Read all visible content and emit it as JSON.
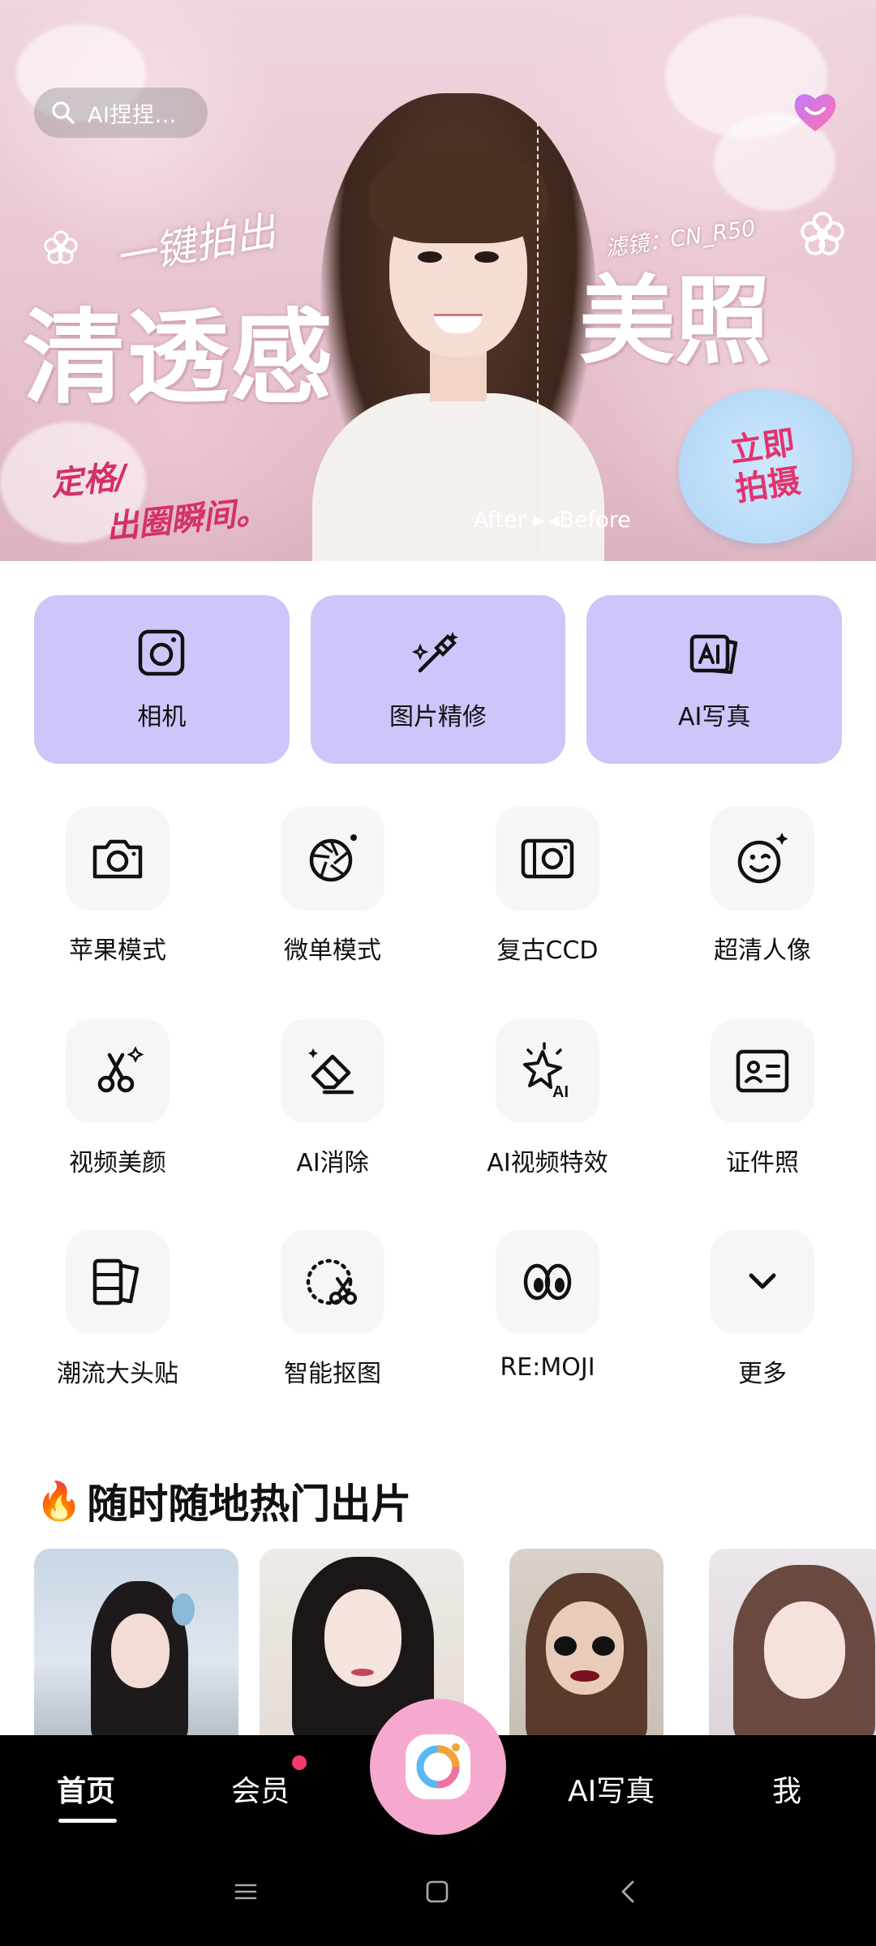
{
  "banner": {
    "search_text": "AI捏捏…",
    "slogan_small": "一键拍出",
    "slogan_big": "清透感",
    "slogan_right": "美照",
    "filter_label": "滤镜：CN_R50",
    "tagline_line1": "定格/",
    "tagline_line2": "出圈瞬间。",
    "after_label": "After ▸",
    "before_label": "◂Before",
    "cta_line1": "立即",
    "cta_line2": "拍摄"
  },
  "main_cards": [
    {
      "label": "相机",
      "icon": "camera-square-icon"
    },
    {
      "label": "图片精修",
      "icon": "magic-brush-icon"
    },
    {
      "label": "AI写真",
      "icon": "ai-photo-icon"
    }
  ],
  "tools": [
    {
      "label": "苹果模式",
      "icon": "camera-icon"
    },
    {
      "label": "微单模式",
      "icon": "aperture-icon"
    },
    {
      "label": "复古CCD",
      "icon": "ccd-camera-icon"
    },
    {
      "label": "超清人像",
      "icon": "wink-face-icon"
    },
    {
      "label": "视频美颜",
      "icon": "scissors-sparkle-icon"
    },
    {
      "label": "AI消除",
      "icon": "eraser-icon"
    },
    {
      "label": "AI视频特效",
      "icon": "ai-sparkle-icon"
    },
    {
      "label": "证件照",
      "icon": "id-card-icon"
    },
    {
      "label": "潮流大头贴",
      "icon": "photo-strip-icon"
    },
    {
      "label": "智能抠图",
      "icon": "cutout-icon"
    },
    {
      "label": "RE:MOJI",
      "icon": "eyes-icon"
    },
    {
      "label": "更多",
      "icon": "chevron-down-icon"
    }
  ],
  "hot_section": {
    "emoji": "🔥",
    "title": "随时随地热门出片"
  },
  "bottom_nav": {
    "home": "首页",
    "vip": "会员",
    "ai_photo": "AI写真",
    "me": "我"
  },
  "colors": {
    "card_bg": "#cfc5fb",
    "tool_bg": "#f6f6f7",
    "camera_button": "#f6a9cf",
    "badge_red": "#f23b6a",
    "tagline": "#d4306a"
  }
}
